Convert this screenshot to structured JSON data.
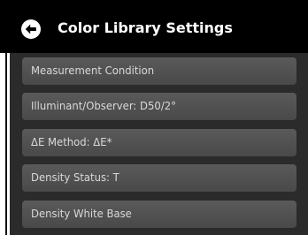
{
  "header": {
    "back_icon": "back-arrow-circle-icon",
    "title": "Color Library Settings"
  },
  "colors": {
    "header_bg": "#000000",
    "content_bg": "#2b2b2b",
    "item_bg": "#505050",
    "item_text": "#d9d9d9"
  },
  "settings": {
    "items": [
      {
        "label": "Measurement Condition"
      },
      {
        "label": "Illuminant/Observer: D50/2°"
      },
      {
        "label": "ΔE Method: ΔE*"
      },
      {
        "label": "Density Status: T"
      },
      {
        "label": "Density White Base"
      }
    ]
  }
}
